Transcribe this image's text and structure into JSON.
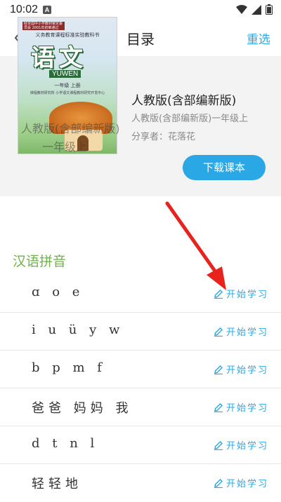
{
  "status_bar": {
    "time": "10:02",
    "notif_label": "A"
  },
  "nav": {
    "title": "目录",
    "reselect_label": "重选"
  },
  "book": {
    "name": "人教版(含部编新版)",
    "edition": "人教版(含部编新版)一年级上",
    "sharer": "分享者：花落花",
    "download_label": "下载课本",
    "cover": {
      "top_badge": "经全国中小学教材审定委员会 2001年初审通过",
      "subtitle": "义务教育课程标准实验教科书",
      "title": "语文",
      "pinyin": "YUWEN",
      "grade": "一年级 上册",
      "publisher": "课程教材研究所 小学语文课程教材研究开发中心",
      "overlay_line1": "人教版(含部编新版)",
      "overlay_line2": "一年级上"
    }
  },
  "section": {
    "title": "汉语拼音"
  },
  "lessons": [
    {
      "name": "ɑ o e",
      "action": "开始学习"
    },
    {
      "name": "i u ü y w",
      "action": "开始学习"
    },
    {
      "name": "b p m f",
      "action": "开始学习"
    },
    {
      "name": "爸爸 妈妈 我",
      "action": "开始学习"
    },
    {
      "name": "d t n l",
      "action": "开始学习"
    },
    {
      "name": "轻轻地",
      "action": "开始学习"
    }
  ],
  "colors": {
    "accent": "#2aa8e6",
    "section_green": "#6ab544",
    "annotation_red": "#e8231e"
  },
  "icons": {
    "back": "chevron-left-icon",
    "edit": "pencil-icon"
  }
}
